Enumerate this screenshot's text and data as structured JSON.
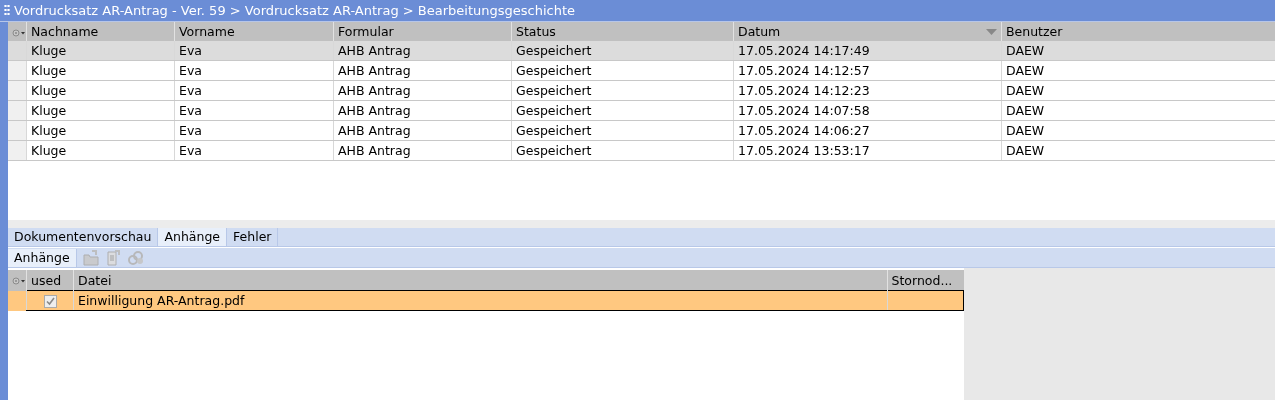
{
  "window": {
    "title": "Vordrucksatz AR-Antrag - Ver. 59 > Vordrucksatz AR-Antrag > Bearbeitungsgeschichte"
  },
  "history": {
    "columns": [
      {
        "label": "Nachname",
        "sorted": false
      },
      {
        "label": "Vorname",
        "sorted": false
      },
      {
        "label": "Formular",
        "sorted": false
      },
      {
        "label": "Status",
        "sorted": false
      },
      {
        "label": "Datum",
        "sorted": true
      },
      {
        "label": "Benutzer",
        "sorted": false
      }
    ],
    "rows": [
      {
        "selected": true,
        "cells": [
          "Kluge",
          "Eva",
          "AHB Antrag",
          "Gespeichert",
          "17.05.2024 14:17:49",
          "DAEW"
        ]
      },
      {
        "selected": false,
        "cells": [
          "Kluge",
          "Eva",
          "AHB Antrag",
          "Gespeichert",
          "17.05.2024 14:12:57",
          "DAEW"
        ]
      },
      {
        "selected": false,
        "cells": [
          "Kluge",
          "Eva",
          "AHB Antrag",
          "Gespeichert",
          "17.05.2024 14:12:23",
          "DAEW"
        ]
      },
      {
        "selected": false,
        "cells": [
          "Kluge",
          "Eva",
          "AHB Antrag",
          "Gespeichert",
          "17.05.2024 14:07:58",
          "DAEW"
        ]
      },
      {
        "selected": false,
        "cells": [
          "Kluge",
          "Eva",
          "AHB Antrag",
          "Gespeichert",
          "17.05.2024 14:06:27",
          "DAEW"
        ]
      },
      {
        "selected": false,
        "cells": [
          "Kluge",
          "Eva",
          "AHB Antrag",
          "Gespeichert",
          "17.05.2024 13:53:17",
          "DAEW"
        ]
      }
    ]
  },
  "tabs": [
    {
      "label": "Dokumentenvorschau",
      "selected": false
    },
    {
      "label": "Anhänge",
      "selected": true
    },
    {
      "label": "Fehler",
      "selected": false
    }
  ],
  "subtabs": [
    {
      "label": "Anhänge",
      "selected": true
    }
  ],
  "attachments": {
    "columns": [
      "used",
      "Datei",
      "Stornod..."
    ],
    "rows": [
      {
        "selected": true,
        "used": true,
        "file": "Einwilligung AR-Antrag.pdf"
      }
    ]
  }
}
